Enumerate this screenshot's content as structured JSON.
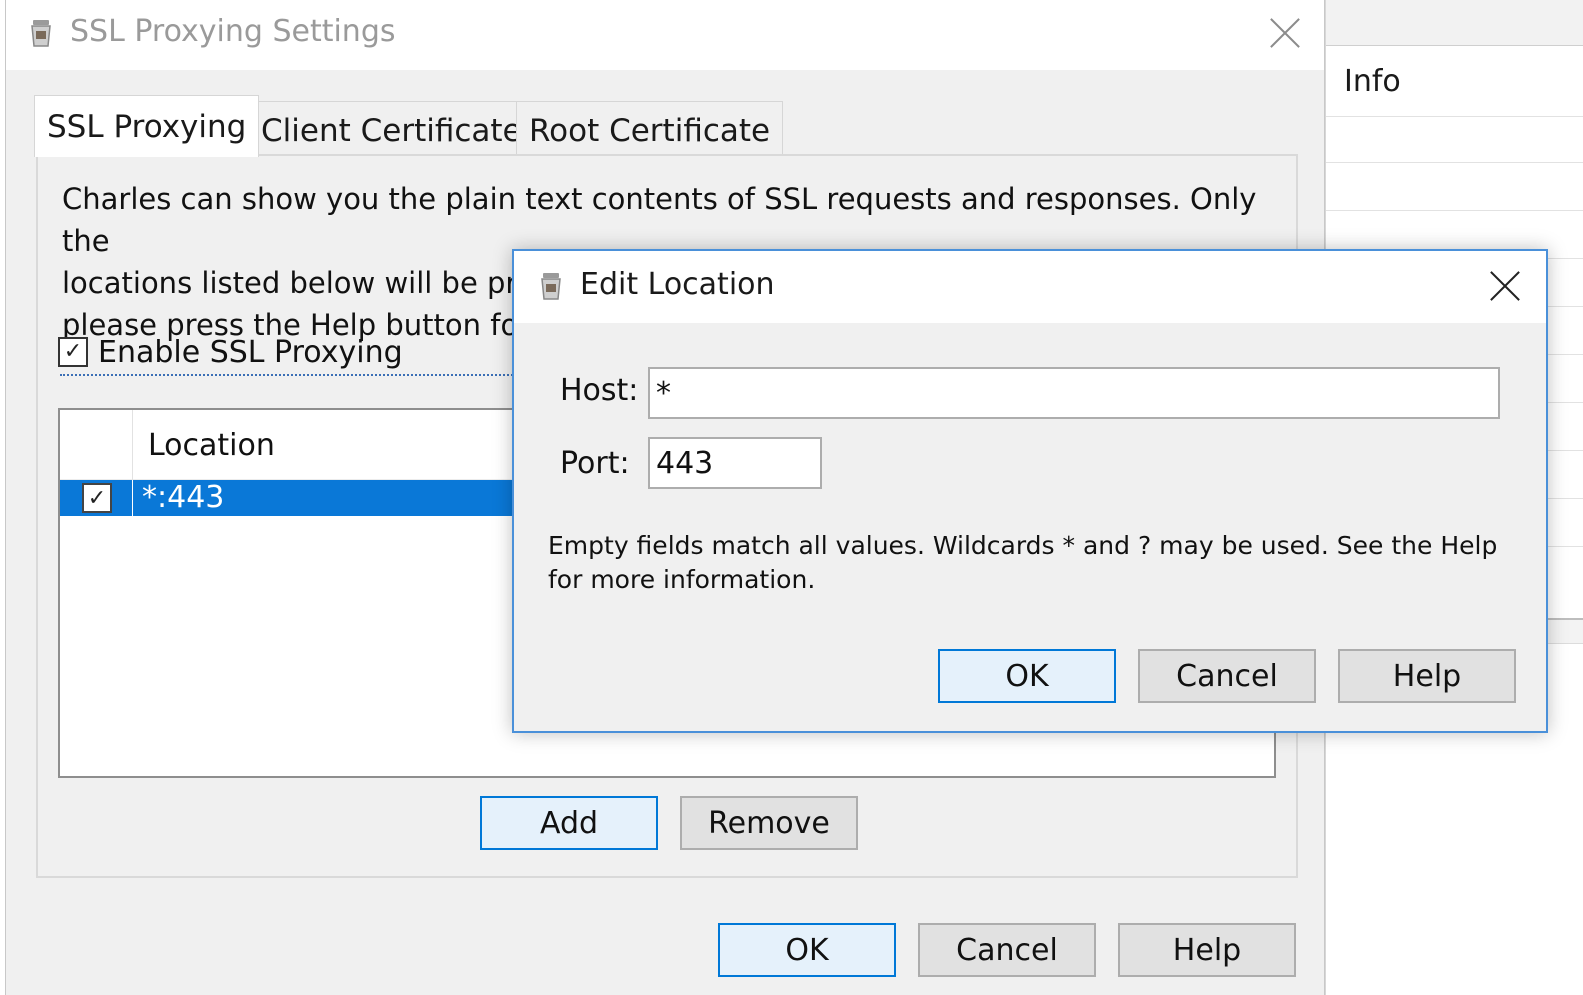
{
  "background_app": {
    "column_header": "Info"
  },
  "main_dialog": {
    "title": "SSL Proxying Settings",
    "tabs": [
      {
        "label": "SSL Proxying",
        "active": true
      },
      {
        "label": "Client Certificates",
        "active": false
      },
      {
        "label": "Root Certificate",
        "active": false
      }
    ],
    "description": "Charles can show you the plain text contents of SSL requests and responses. Only the\nlocations listed below will be proxied. Charles will issue and sign SSL certificates,\nplease press the Help button for",
    "enable_checkbox": {
      "label": "Enable SSL Proxying",
      "checked": true
    },
    "location_table": {
      "column_header": "Location",
      "rows": [
        {
          "checked": true,
          "location": "*:443",
          "selected": true
        }
      ]
    },
    "add_label": "Add",
    "remove_label": "Remove",
    "ok_label": "OK",
    "cancel_label": "Cancel",
    "help_label": "Help"
  },
  "edit_dialog": {
    "title": "Edit Location",
    "host_label": "Host:",
    "host_value": "*",
    "port_label": "Port:",
    "port_value": "443",
    "hint": "Empty fields match all values. Wildcards * and ? may be used. See the Help for more information.",
    "ok_label": "OK",
    "cancel_label": "Cancel",
    "help_label": "Help"
  },
  "colors": {
    "selection": "#0a78d7",
    "default_button_border": "#0078d7",
    "dialog_bg": "#f0f0f0"
  },
  "icons": {
    "app_icon": "charles-jar-icon",
    "close_icon": "close-icon",
    "check_icon": "checkmark-icon"
  }
}
